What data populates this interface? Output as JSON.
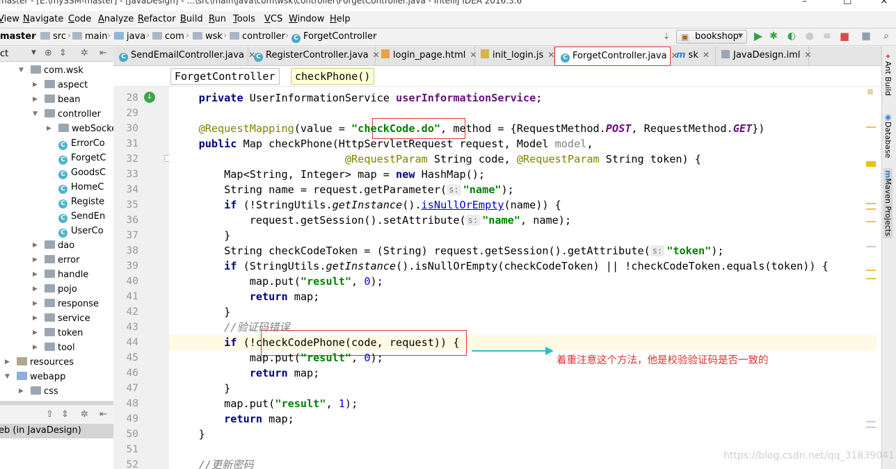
{
  "window": {
    "title": "master - [E:\\mySSM-master] - [JavaDesign] - ...\\src\\main\\java\\com\\wsk\\controller\\ForgetController.java - IntelliJ IDEA 2016.3.6"
  },
  "menu": [
    "View",
    "Navigate",
    "Code",
    "Analyze",
    "Refactor",
    "Build",
    "Run",
    "Tools",
    "VCS",
    "Window",
    "Help"
  ],
  "breadcrumbs": [
    "master",
    "src",
    "main",
    "java",
    "com",
    "wsk",
    "controller",
    "ForgetController"
  ],
  "run_config": "bookshop",
  "project_panel": {
    "header_label": "ct",
    "tree": [
      {
        "label": "com.wsk",
        "kind": "package",
        "depth": 1,
        "expanded": true
      },
      {
        "label": "aspect",
        "kind": "package",
        "depth": 2,
        "expanded": false
      },
      {
        "label": "bean",
        "kind": "package",
        "depth": 2,
        "expanded": false
      },
      {
        "label": "controller",
        "kind": "package",
        "depth": 2,
        "expanded": true
      },
      {
        "label": "webSocke",
        "kind": "package",
        "depth": 3,
        "expanded": false
      },
      {
        "label": "ErrorCo",
        "kind": "class",
        "depth": 3
      },
      {
        "label": "ForgetC",
        "kind": "class",
        "depth": 3
      },
      {
        "label": "GoodsC",
        "kind": "class",
        "depth": 3
      },
      {
        "label": "HomeC",
        "kind": "class",
        "depth": 3
      },
      {
        "label": "Registe",
        "kind": "class",
        "depth": 3
      },
      {
        "label": "SendEn",
        "kind": "class",
        "depth": 3
      },
      {
        "label": "UserCo",
        "kind": "class",
        "depth": 3
      },
      {
        "label": "dao",
        "kind": "package",
        "depth": 2,
        "expanded": false
      },
      {
        "label": "error",
        "kind": "package",
        "depth": 2,
        "expanded": false
      },
      {
        "label": "handle",
        "kind": "package",
        "depth": 2,
        "expanded": false
      },
      {
        "label": "pojo",
        "kind": "package",
        "depth": 2,
        "expanded": false
      },
      {
        "label": "response",
        "kind": "package",
        "depth": 2,
        "expanded": false
      },
      {
        "label": "service",
        "kind": "package",
        "depth": 2,
        "expanded": false
      },
      {
        "label": "token",
        "kind": "package",
        "depth": 2,
        "expanded": false
      },
      {
        "label": "tool",
        "kind": "package",
        "depth": 2,
        "expanded": false
      },
      {
        "label": "resources",
        "kind": "resources",
        "depth": 0,
        "expanded": false
      },
      {
        "label": "webapp",
        "kind": "web",
        "depth": 0,
        "expanded": true
      },
      {
        "label": "css",
        "kind": "folder",
        "depth": 1,
        "expanded": false
      }
    ],
    "bottom_item": "eb (in JavaDesign)"
  },
  "tabs": [
    {
      "label": "SendEmailController.java",
      "icon": "c",
      "active": false
    },
    {
      "label": "RegisterController.java",
      "icon": "c",
      "active": false
    },
    {
      "label": "login_page.html",
      "icon": "html",
      "active": false
    },
    {
      "label": "init_login.js",
      "icon": "js",
      "active": false
    },
    {
      "label": "ForgetController.java",
      "icon": "c",
      "active": true
    },
    {
      "label": "sk",
      "icon": "m",
      "active": false
    },
    {
      "label": "JavaDesign.iml",
      "icon": "iml",
      "active": false
    }
  ],
  "editor_breadcrumbs": [
    "ForgetController",
    "checkPhone()"
  ],
  "line_numbers": [
    "28",
    "29",
    "30",
    "31",
    "32",
    "33",
    "34",
    "35",
    "36",
    "37",
    "38",
    "39",
    "40",
    "41",
    "42",
    "43",
    "44",
    "45",
    "46",
    "47",
    "48",
    "49",
    "50",
    "51",
    "52"
  ],
  "code": [
    [
      [
        "    ",
        ""
      ],
      [
        "private",
        "kw"
      ],
      [
        " UserInformationService ",
        ""
      ],
      [
        "userInformationService",
        "fd"
      ],
      [
        ";",
        ""
      ]
    ],
    [],
    [
      [
        "    ",
        ""
      ],
      [
        "@RequestMapping",
        "an"
      ],
      [
        "(value = ",
        ""
      ],
      [
        "\"checkCode.do\"",
        "st"
      ],
      [
        ", method = {RequestMethod.",
        ""
      ],
      [
        "POST",
        "en"
      ],
      [
        ", RequestMethod.",
        ""
      ],
      [
        "GET",
        "en"
      ],
      [
        "})",
        ""
      ]
    ],
    [
      [
        "    ",
        ""
      ],
      [
        "public",
        "kw"
      ],
      [
        " Map checkPhone(HttpServletRequest request, Model ",
        ""
      ],
      [
        "model",
        "gr"
      ],
      [
        ",",
        ""
      ]
    ],
    [
      [
        "                           ",
        ""
      ],
      [
        "@RequestParam",
        "an"
      ],
      [
        " String code, ",
        ""
      ],
      [
        "@RequestParam",
        "an"
      ],
      [
        " String token) {",
        ""
      ]
    ],
    [
      [
        "        Map<String, Integer> map = ",
        ""
      ],
      [
        "new",
        "kw"
      ],
      [
        " HashMap();",
        ""
      ]
    ],
    [
      [
        "        String name = request.getParameter(",
        ""
      ],
      [
        "s:",
        "hint"
      ],
      [
        "\"name\"",
        "st"
      ],
      [
        ");",
        ""
      ]
    ],
    [
      [
        "        ",
        ""
      ],
      [
        "if",
        "kw"
      ],
      [
        " (!StringUtils.",
        ""
      ],
      [
        "getInstance",
        "it"
      ],
      [
        "().",
        ""
      ],
      [
        "isNullOrEmpty",
        "ul"
      ],
      [
        "(name)) {",
        ""
      ]
    ],
    [
      [
        "            request.getSession().setAttribute(",
        ""
      ],
      [
        "s:",
        "hint"
      ],
      [
        "\"name\"",
        "st"
      ],
      [
        ", name);",
        ""
      ]
    ],
    [
      [
        "        }",
        ""
      ]
    ],
    [
      [
        "        String checkCodeToken = (String) request.getSession().getAttribute(",
        ""
      ],
      [
        "s:",
        "hint"
      ],
      [
        "\"token\"",
        "st"
      ],
      [
        ");",
        ""
      ]
    ],
    [
      [
        "        ",
        ""
      ],
      [
        "if",
        "kw"
      ],
      [
        " (StringUtils.",
        ""
      ],
      [
        "getInstance",
        "it"
      ],
      [
        "().isNullOrEmpty(checkCodeToken) || !checkCodeToken.equals(token)) {",
        ""
      ]
    ],
    [
      [
        "            map.put(",
        ""
      ],
      [
        "\"result\"",
        "st"
      ],
      [
        ", ",
        ""
      ],
      [
        "0",
        "nm"
      ],
      [
        ");",
        ""
      ]
    ],
    [
      [
        "            ",
        ""
      ],
      [
        "return",
        "kw"
      ],
      [
        " map;",
        ""
      ]
    ],
    [
      [
        "        }",
        ""
      ]
    ],
    [
      [
        "        ",
        ""
      ],
      [
        "//验证码错误",
        "cm"
      ]
    ],
    [
      [
        "        ",
        ""
      ],
      [
        "if",
        "kw"
      ],
      [
        " (!checkCodePhone(code, request)) {",
        ""
      ]
    ],
    [
      [
        "            map.put(",
        ""
      ],
      [
        "\"result\"",
        "st"
      ],
      [
        ", ",
        ""
      ],
      [
        "0",
        "nm"
      ],
      [
        ");",
        ""
      ]
    ],
    [
      [
        "            ",
        ""
      ],
      [
        "return",
        "kw"
      ],
      [
        " map;",
        ""
      ]
    ],
    [
      [
        "        }",
        ""
      ]
    ],
    [
      [
        "        map.put(",
        ""
      ],
      [
        "\"result\"",
        "st"
      ],
      [
        ", ",
        ""
      ],
      [
        "1",
        "nm"
      ],
      [
        ");",
        ""
      ]
    ],
    [
      [
        "        ",
        ""
      ],
      [
        "return",
        "kw"
      ],
      [
        " map;",
        ""
      ]
    ],
    [
      [
        "    }",
        ""
      ]
    ],
    [],
    [
      [
        "    ",
        ""
      ],
      [
        "//更新密码",
        "cm"
      ]
    ]
  ],
  "annotation": "着重注意这个方法，他是校验验证码是否一致的",
  "watermark": "https://blog.csdn.net/qq_31839041",
  "right_tools": [
    "Ant Build",
    "Database",
    "Maven Projects"
  ],
  "colors": {
    "annotation": "#e03131",
    "keyword": "#000080",
    "string": "#008000",
    "annotation_kw": "#808000"
  }
}
